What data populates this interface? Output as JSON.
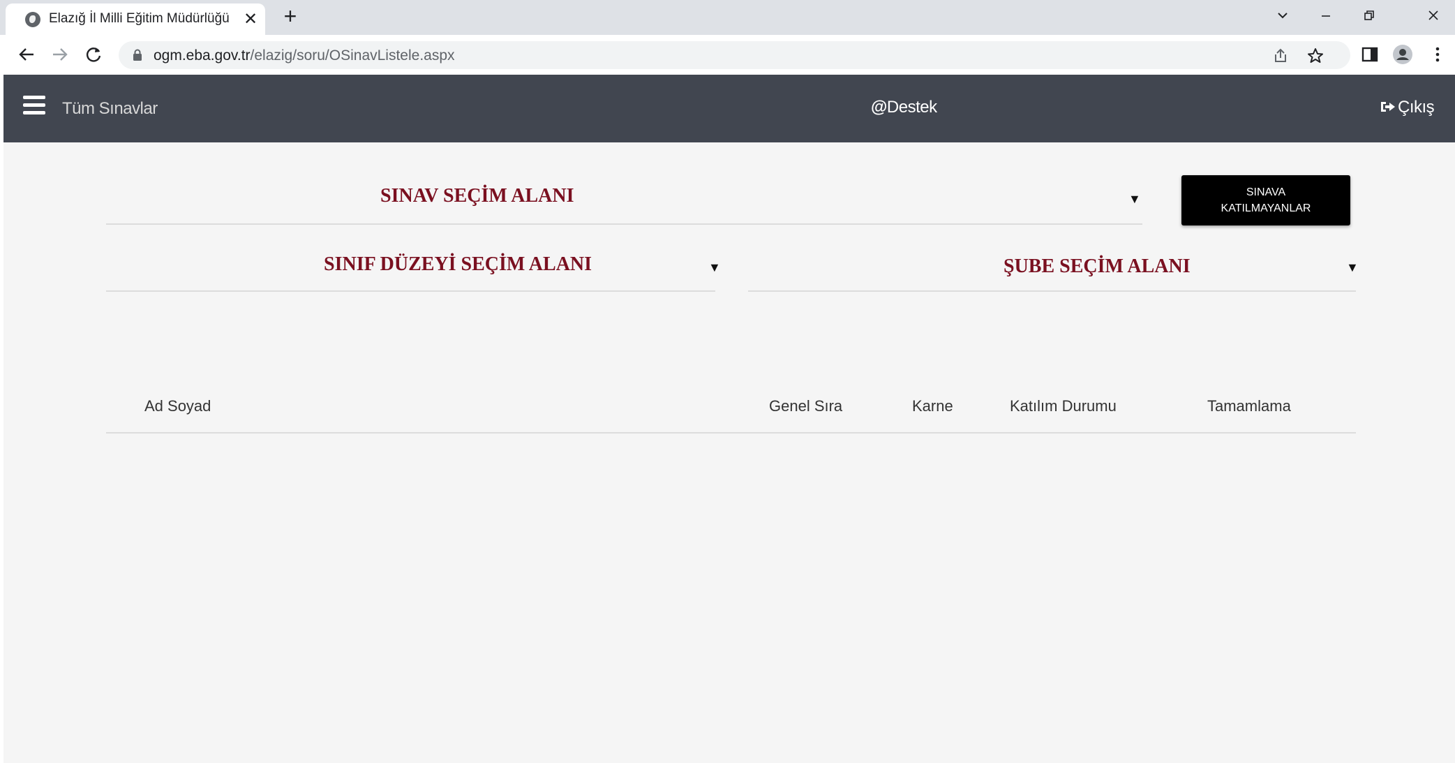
{
  "browser": {
    "tab_title": "Elazığ İl Milli Eğitim Müdürlüğü",
    "tab_close": "✕",
    "new_tab": "+",
    "url_domain": "ogm.eba.gov.tr",
    "url_path": "/elazig/soru/OSinavListele.aspx"
  },
  "navbar": {
    "title": "Tüm Sınavlar",
    "support_at": "@",
    "support_label": "Destek",
    "logout_label": "Çıkış",
    "background": "#414650"
  },
  "filters": {
    "exam_select_label": "SINAV SEÇİM ALANI",
    "grade_select_label": "SINIF DÜZEYİ SEÇİM ALANI",
    "branch_select_label": "ŞUBE SEÇİM ALANI",
    "arrow": "▼",
    "label_color": "#7a1020"
  },
  "absent_button": {
    "line1": "SINAVA",
    "line2": "KATILMAYANLAR"
  },
  "table": {
    "columns": [
      "Ad Soyad",
      "Genel Sıra",
      "Karne",
      "Katılım Durumu",
      "Tamamlama"
    ],
    "rows": []
  }
}
